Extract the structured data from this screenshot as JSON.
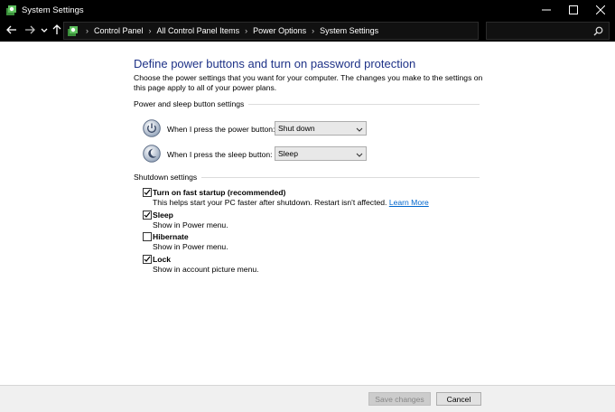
{
  "window": {
    "title": "System Settings",
    "app_icon": "control-panel-icon",
    "controls": [
      "minimize-icon",
      "maximize-icon",
      "close-icon"
    ]
  },
  "nav": {
    "back_icon": "back-arrow-icon",
    "forward_icon": "forward-arrow-icon",
    "recent_icon": "chevron-down-icon",
    "up_icon": "up-arrow-icon"
  },
  "address": {
    "breadcrumbs": [
      "Control Panel",
      "All Control Panel Items",
      "Power Options",
      "System Settings"
    ],
    "location_icon": "control-panel-icon",
    "dropdown_icon": "chevron-down-icon",
    "refresh_icon": "refresh-icon"
  },
  "search": {
    "value": "",
    "icon": "search-icon"
  },
  "content": {
    "heading": "Define power buttons and turn on password protection",
    "description": "Choose the power settings that you want for your computer. The changes you make to the settings on this page apply to all of your power plans.",
    "power_section": {
      "label": "Power and sleep button settings",
      "power_button": {
        "label": "When I press the power button:",
        "value": "Shut down",
        "icon": "power-button-icon"
      },
      "sleep_button": {
        "label": "When I press the sleep button:",
        "value": "Sleep",
        "icon": "sleep-moon-icon"
      }
    },
    "shutdown_section": {
      "label": "Shutdown settings",
      "options": [
        {
          "title": "Turn on fast startup (recommended)",
          "desc": "This helps start your PC faster after shutdown. Restart isn't affected.",
          "link": "Learn More",
          "checked": true
        },
        {
          "title": "Sleep",
          "desc": "Show in Power menu.",
          "checked": true
        },
        {
          "title": "Hibernate",
          "desc": "Show in Power menu.",
          "checked": false
        },
        {
          "title": "Lock",
          "desc": "Show in account picture menu.",
          "checked": true
        }
      ]
    }
  },
  "footer": {
    "save_label": "Save changes",
    "cancel_label": "Cancel"
  },
  "colors": {
    "heading": "#1e3287",
    "link": "#0066cc",
    "titlebar": "#000000"
  }
}
